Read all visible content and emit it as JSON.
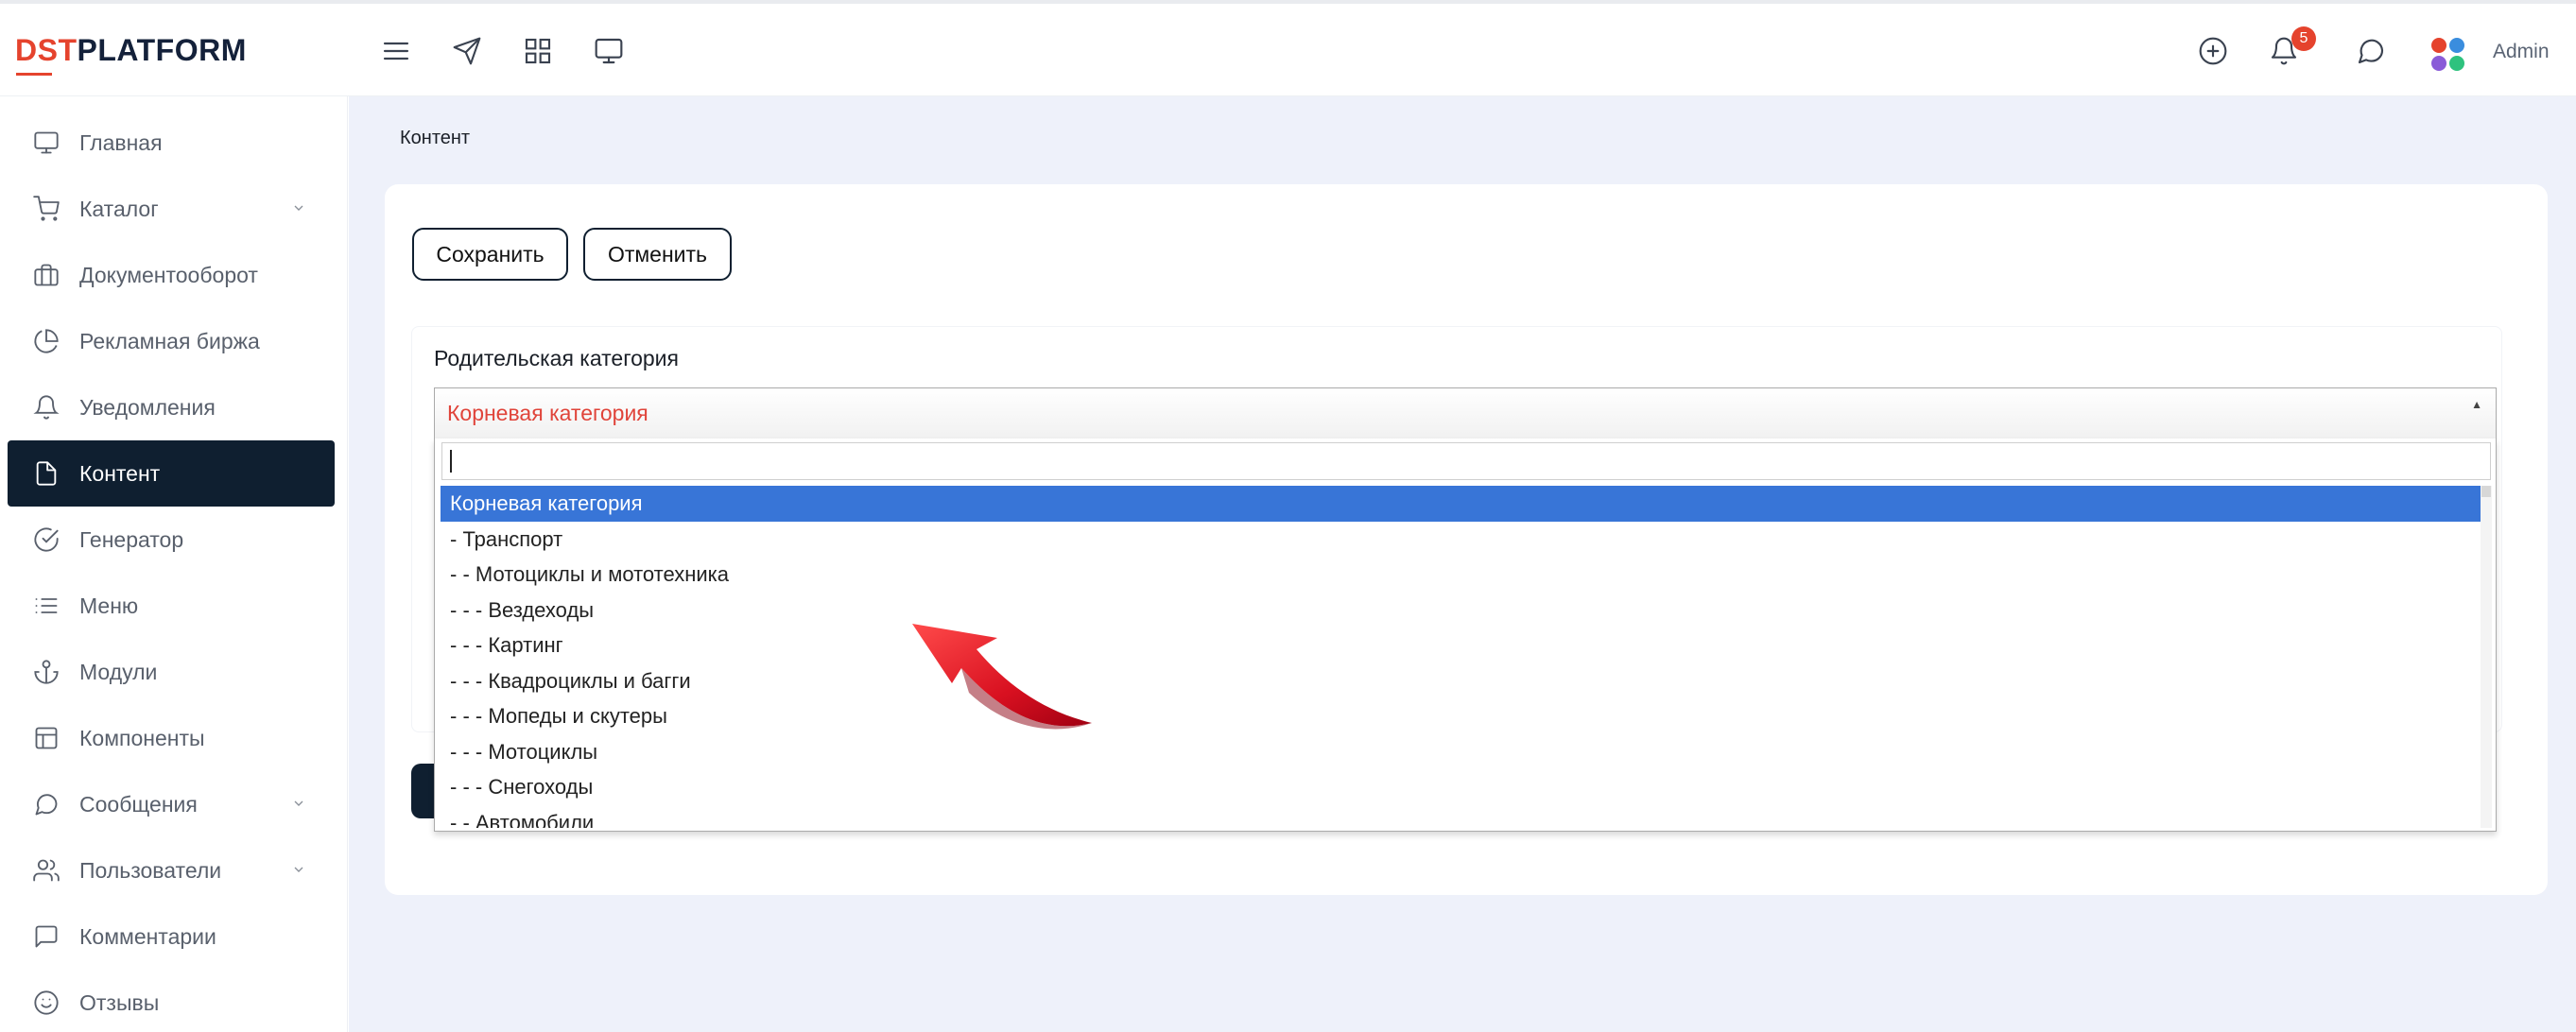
{
  "header": {
    "logo_brand": "DST",
    "logo_rest": "PLATFORM",
    "notifications_count": "5",
    "user_label": "Admin",
    "icons": [
      "menu-icon",
      "send-icon",
      "grid-icon",
      "monitor-icon",
      "plus-circle-icon",
      "bell-icon",
      "chat-icon"
    ]
  },
  "sidebar": {
    "items": [
      {
        "label": "Главная",
        "icon": "monitor-icon"
      },
      {
        "label": "Каталог",
        "icon": "cart-icon",
        "has_chevron": true
      },
      {
        "label": "Документооборот",
        "icon": "briefcase-icon"
      },
      {
        "label": "Рекламная биржа",
        "icon": "pie-chart-icon"
      },
      {
        "label": "Уведомления",
        "icon": "bell-icon"
      },
      {
        "label": "Контент",
        "icon": "file-icon",
        "active": true
      },
      {
        "label": "Генератор",
        "icon": "check-circle-icon"
      },
      {
        "label": "Меню",
        "icon": "list-icon"
      },
      {
        "label": "Модули",
        "icon": "anchor-icon"
      },
      {
        "label": "Компоненты",
        "icon": "layout-icon"
      },
      {
        "label": "Сообщения",
        "icon": "message-circle-icon",
        "has_chevron": true
      },
      {
        "label": "Пользователи",
        "icon": "users-icon",
        "has_chevron": true
      },
      {
        "label": "Комментарии",
        "icon": "message-square-icon"
      },
      {
        "label": "Отзывы",
        "icon": "smile-icon"
      }
    ]
  },
  "main": {
    "breadcrumb": "Контент",
    "save_label": "Сохранить",
    "cancel_label": "Отменить",
    "parent_category_label": "Родительская категория",
    "select": {
      "value": "Корневая категория",
      "search_value": "",
      "options": [
        "Корневая категория",
        "- Транспорт",
        "- - Мотоциклы и мототехника",
        "- - - Вездеходы",
        "- - - Картинг",
        "- - - Квадроциклы и багги",
        "- - - Мопеды и скутеры",
        "- - - Мотоциклы",
        "- - - Снегоходы",
        "- - Автомобили"
      ],
      "highlighted_index": 0
    }
  },
  "colors": {
    "accent": "#e5432d",
    "sidebar_active": "#0f1f30",
    "option_highlight": "#3875d7",
    "main_bg": "#eef1fa"
  }
}
